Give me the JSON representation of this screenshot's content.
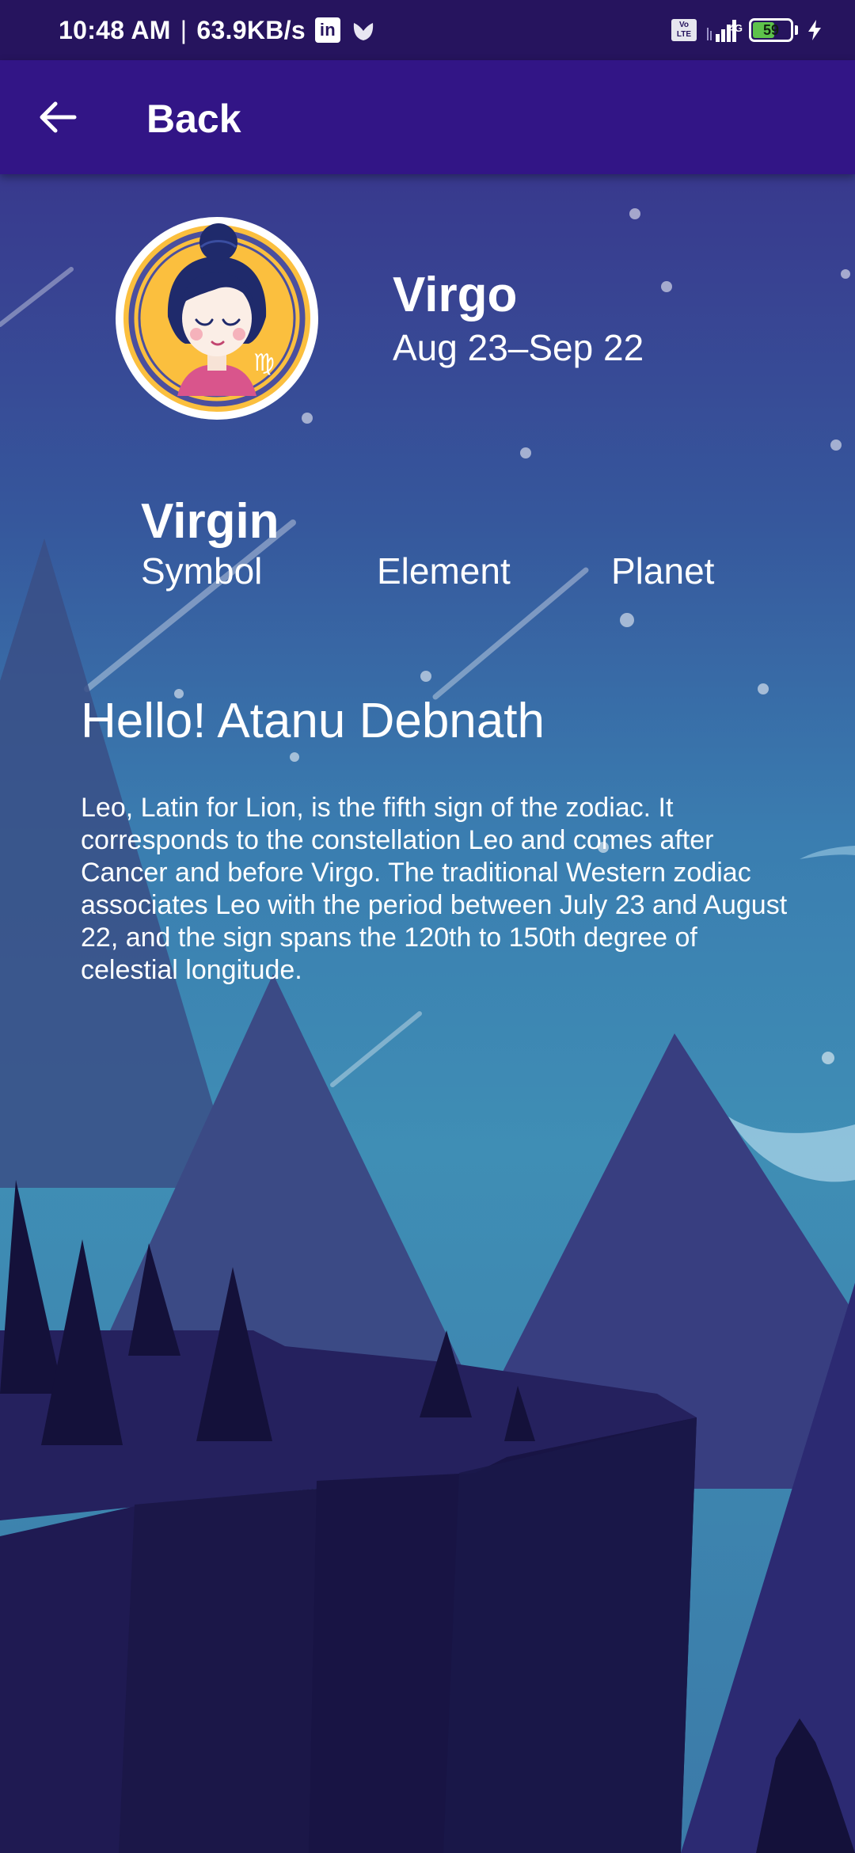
{
  "status_bar": {
    "time": "10:48 AM",
    "separator": "|",
    "net_speed": "63.9KB/s",
    "linkedin_glyph": "in",
    "volte_top": "Vo",
    "volte_bottom": "LTE",
    "network_type": "4G",
    "battery_level": "59",
    "battery_fraction": 0.59,
    "icons": [
      "linkedin-icon",
      "tulip-icon",
      "volte-icon",
      "signal-icon",
      "battery-icon",
      "charging-icon"
    ]
  },
  "app_bar": {
    "back_label": "Back",
    "back_icon": "arrow-left-icon"
  },
  "sign": {
    "name": "Virgo",
    "dates": "Aug 23–Sep 22",
    "glyph": "♍",
    "avatar_icon": "virgo-avatar-icon"
  },
  "attributes": {
    "symbol_value": "Virgin",
    "symbol_label": "Symbol",
    "element_label": "Element",
    "planet_label": "Planet"
  },
  "greeting": "Hello! Atanu Debnath",
  "description": "Leo, Latin for Lion, is the fifth sign of the zodiac. It corresponds to the constellation Leo and comes after Cancer and before Virgo. The traditional Western zodiac associates Leo with the period between July 23 and August 22, and the sign spans the 120th to 150th degree of celestial longitude.",
  "colors": {
    "status_bar": "#26145e",
    "app_bar": "#321586",
    "sky_top": "#3a2a86",
    "sky_mid": "#36679e",
    "sky_low": "#3f8eb5",
    "avatar_ring": "#ffffff",
    "avatar_face_bg": "#fbbf3e",
    "avatar_border": "#4b4f9e",
    "text": "#ffffff"
  }
}
